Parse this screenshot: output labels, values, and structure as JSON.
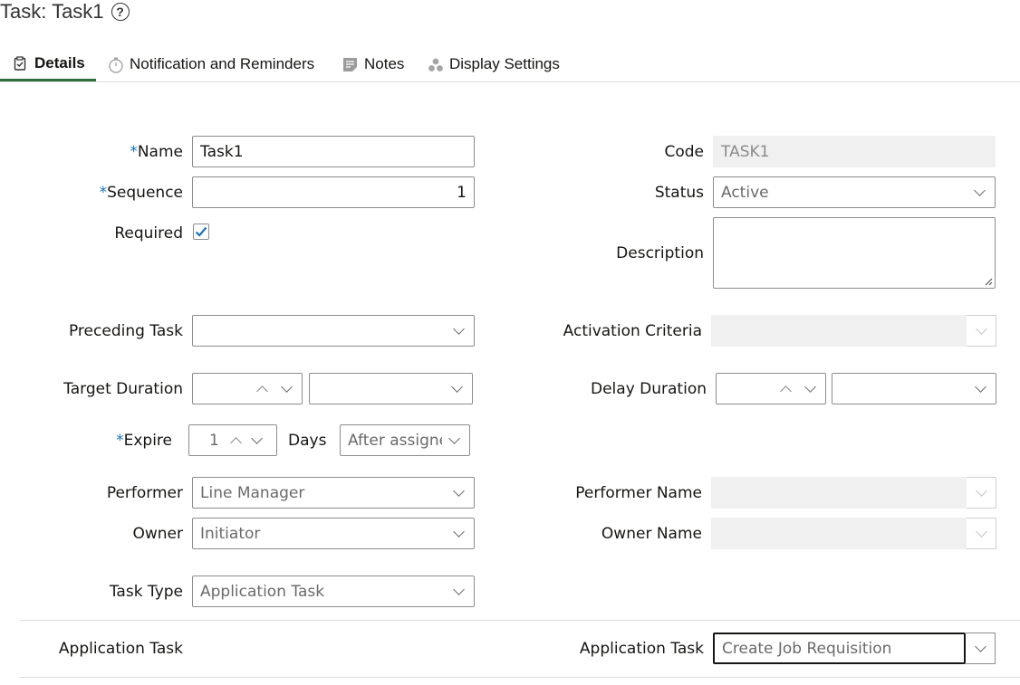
{
  "header": {
    "title": "Task: Task1",
    "help_icon": "question-circle-icon"
  },
  "tabs": [
    {
      "label": "Details",
      "icon": "clipboard-check-icon",
      "active": true
    },
    {
      "label": "Notification and Reminders",
      "icon": "stopwatch-icon",
      "active": false
    },
    {
      "label": "Notes",
      "icon": "note-icon",
      "active": false
    },
    {
      "label": "Display Settings",
      "icon": "dots-cluster-icon",
      "active": false
    }
  ],
  "form": {
    "required_marker": "*",
    "name": {
      "label": "Name",
      "value": "Task1"
    },
    "sequence": {
      "label": "Sequence",
      "value": "1"
    },
    "required": {
      "label": "Required",
      "checked": true
    },
    "code": {
      "label": "Code",
      "value": "TASK1"
    },
    "status": {
      "label": "Status",
      "value": "Active"
    },
    "description": {
      "label": "Description",
      "value": ""
    },
    "preceding_task": {
      "label": "Preceding Task",
      "value": ""
    },
    "activation_criteria": {
      "label": "Activation Criteria",
      "value": ""
    },
    "target_duration": {
      "label": "Target Duration",
      "value": "",
      "unit": ""
    },
    "delay_duration": {
      "label": "Delay Duration",
      "value": "",
      "unit": ""
    },
    "expire": {
      "label": "Expire",
      "value": "1",
      "unit_label": "Days",
      "timing": "After assigne"
    },
    "performer": {
      "label": "Performer",
      "value": "Line Manager"
    },
    "performer_name": {
      "label": "Performer Name",
      "value": ""
    },
    "owner": {
      "label": "Owner",
      "value": "Initiator"
    },
    "owner_name": {
      "label": "Owner Name",
      "value": ""
    },
    "task_type": {
      "label": "Task Type",
      "value": "Application Task"
    }
  },
  "section": {
    "title": "Application Task",
    "application_task": {
      "label": "Application Task",
      "value": "Create Job Requisition"
    }
  },
  "colors": {
    "required": "#1a73b8",
    "active_tab": "#2d6e3e",
    "checkbox": "#1a73b8"
  }
}
